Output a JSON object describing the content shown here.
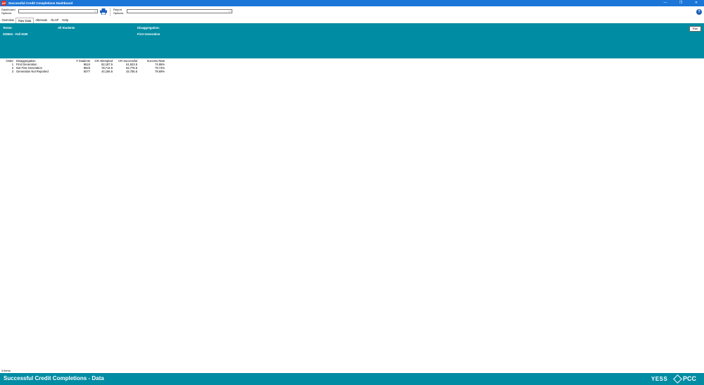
{
  "window": {
    "app_icon": "AP",
    "title": "Successful Credit Completions Dashboard",
    "minimize": "—",
    "maximize": "❐",
    "close": "✕"
  },
  "toolbar": {
    "dashboard_label_1": "Dashboard",
    "dashboard_label_2": "Options:",
    "dashboard_value": "",
    "report_label_1": "Report",
    "report_label_2": "Options:",
    "report_value": "",
    "chevron": "⌵",
    "help": "?"
  },
  "tabs": [
    {
      "label": "Overview"
    },
    {
      "label": "Raw Data"
    },
    {
      "label": "Alternate"
    },
    {
      "label": "OLAP"
    },
    {
      "label": "Help"
    }
  ],
  "panel": {
    "terms_label": "Terms:",
    "terms_value": "202604 - Fall 2026",
    "population": "All Students",
    "disagg_label": "Disaggregation:",
    "disagg_value": "First Generation",
    "run_label": "Run"
  },
  "table": {
    "columns": [
      "Order",
      "Disaggregation",
      "# Students",
      "CR Attempted",
      "CR Successful",
      "Success Rate"
    ],
    "rows": [
      [
        "1",
        "First Generation",
        "8624",
        "82,187.5",
        "61,523.5",
        "74.86%"
      ],
      [
        "2",
        "Not First Generation",
        "8823",
        "78,714.5",
        "62,775.5",
        "79.74%"
      ],
      [
        "3",
        "Generation Not Reported",
        "5077",
        "44,166.5",
        "34,755.5",
        "78.69%"
      ]
    ]
  },
  "status": {
    "items": "3 items"
  },
  "footer": {
    "title": "Successful Credit Completions - Data",
    "logo_yess": "YESS",
    "logo_pcc": "PCC"
  },
  "colors": {
    "accent": "#008ca3",
    "titlebar": "#1b76d8"
  }
}
